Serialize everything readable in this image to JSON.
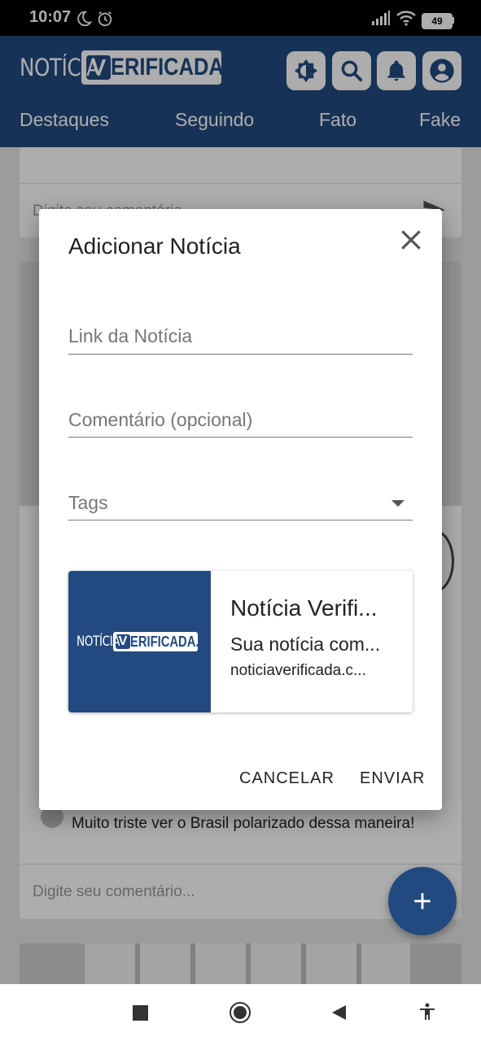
{
  "status_bar": {
    "time": "10:07",
    "battery": "49"
  },
  "header": {
    "logo_left": "NOTÍCIA",
    "logo_v": "V",
    "logo_right": "ERIFICADA.",
    "tabs": [
      "Destaques",
      "Seguindo",
      "Fato",
      "Fake"
    ]
  },
  "feed": {
    "comment_placeholder_top": "Digite seu comentário...",
    "comment_text": "Muito triste ver o Brasil polarizado dessa maneira!",
    "comment_placeholder_bottom": "Digite seu comentário..."
  },
  "dialog": {
    "title": "Adicionar Notícia",
    "link_label": "Link da Notícia",
    "comment_label": "Comentário (opcional)",
    "tags_label": "Tags",
    "preview": {
      "logo_left": "NOTÍCIA",
      "logo_v": "V",
      "logo_right": "ERIFICADA.",
      "title": "Notícia Verifi...",
      "description": "Sua notícia com...",
      "domain": "noticiaverificada.c..."
    },
    "cancel_label": "CANCELAR",
    "send_label": "ENVIAR"
  },
  "colors": {
    "brand": "#224a80",
    "white": "#ffffff"
  },
  "icons": [
    "moon-icon",
    "alarm-icon",
    "signal-icon",
    "wifi-icon",
    "battery-icon",
    "theme-toggle-icon",
    "search-icon",
    "bell-icon",
    "account-icon",
    "send-icon",
    "close-icon",
    "dropdown-arrow-icon",
    "plus-icon",
    "recents-icon",
    "home-icon",
    "back-icon",
    "accessibility-icon"
  ]
}
